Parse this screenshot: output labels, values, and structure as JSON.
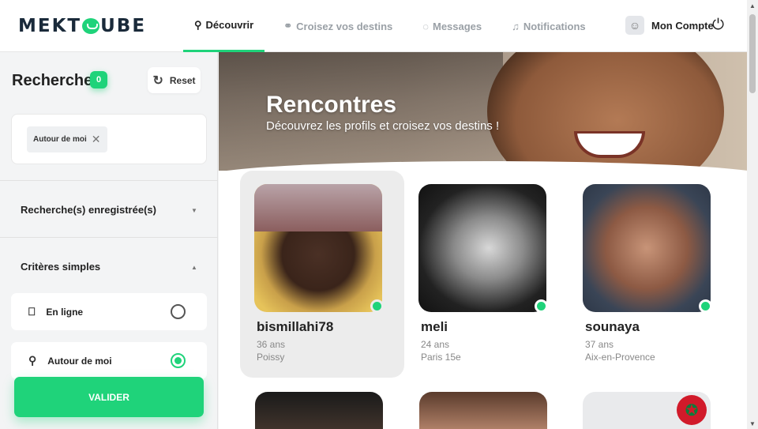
{
  "brand": {
    "logo": "MEKTOUBE",
    "accent": "#1fd37a"
  },
  "nav": {
    "items": [
      {
        "label": "Découvrir",
        "icon": "search-icon",
        "active": true
      },
      {
        "label": "Croisez vos destins",
        "icon": "crossed-paths-icon",
        "active": false
      },
      {
        "label": "Messages",
        "icon": "chat-icon",
        "active": false
      },
      {
        "label": "Notifications",
        "icon": "bell-icon",
        "active": false
      }
    ],
    "account_label": "Mon Compte"
  },
  "sidebar": {
    "title": "Rechercher",
    "badge_count": "0",
    "reset_label": "Reset",
    "active_filter_chip": "Autour de moi",
    "saved_searches_label": "Recherche(s) enregistrée(s)",
    "simple_criteria_label": "Critères simples",
    "options": [
      {
        "label": "En ligne",
        "icon": "online-device-icon",
        "selected": false
      },
      {
        "label": "Autour de moi",
        "icon": "location-pin-icon",
        "selected": true
      }
    ],
    "submit_label": "VALIDER"
  },
  "hero": {
    "title": "Rencontres",
    "subtitle": "Découvrez les profils et croisez vos destins !"
  },
  "profiles": [
    {
      "name": "bismillahi78",
      "age": "36 ans",
      "city": "Poissy",
      "online": true
    },
    {
      "name": "meli",
      "age": "24 ans",
      "city": "Paris 15e",
      "online": true
    },
    {
      "name": "sounaya",
      "age": "37 ans",
      "city": "Aix-en-Provence",
      "online": true
    }
  ]
}
